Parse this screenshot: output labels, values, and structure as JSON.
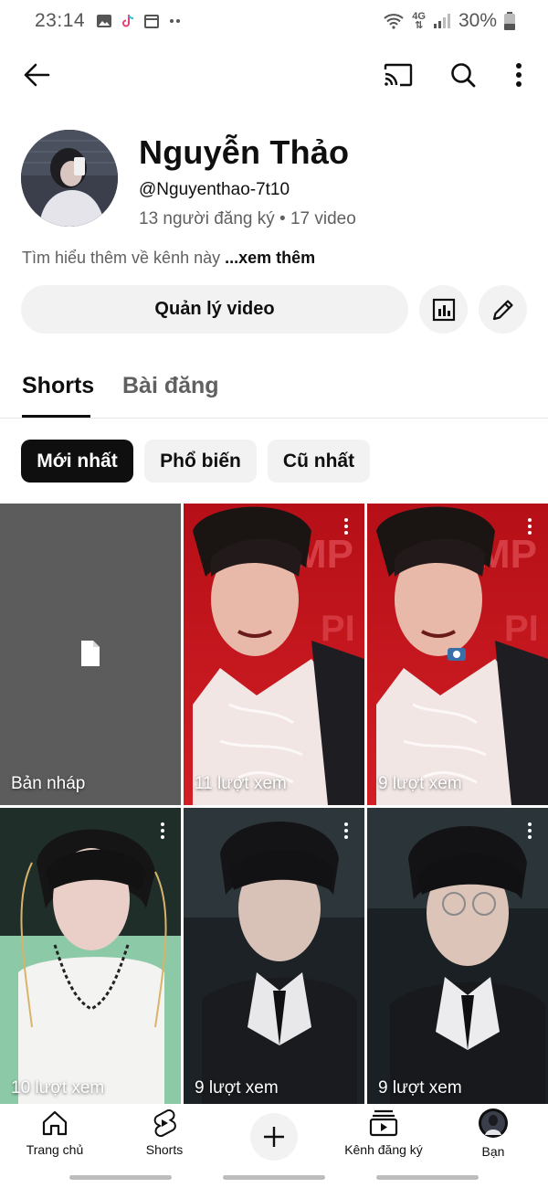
{
  "status_bar": {
    "time": "23:14",
    "network": "4G",
    "battery": "30%"
  },
  "app_bar": {
    "back_icon": "arrow-left-icon",
    "cast_icon": "cast-icon",
    "search_icon": "search-icon",
    "more_icon": "more-vert-icon"
  },
  "channel": {
    "name": "Nguyễn Thảo",
    "handle": "@Nguyenthao-7t10",
    "stats": "13 người đăng ký • 17 video",
    "description": "Tìm hiểu thêm về kênh này ",
    "more_link": "...xem thêm"
  },
  "actions": {
    "manage_label": "Quản lý video",
    "stats_icon": "analytics-icon",
    "edit_icon": "pencil-icon"
  },
  "tabs": [
    {
      "label": "Shorts",
      "active": true
    },
    {
      "label": "Bài đăng",
      "active": false
    }
  ],
  "chips": [
    {
      "label": "Mới nhất",
      "selected": true
    },
    {
      "label": "Phổ biến",
      "selected": false
    },
    {
      "label": "Cũ nhất",
      "selected": false
    }
  ],
  "shorts": [
    {
      "caption": "Bản nháp",
      "kind": "draft"
    },
    {
      "caption": "11 lượt xem",
      "kind": "video"
    },
    {
      "caption": "9 lượt xem",
      "kind": "video"
    },
    {
      "caption": "10 lượt xem",
      "kind": "video"
    },
    {
      "caption": "9 lượt xem",
      "kind": "video"
    },
    {
      "caption": "9 lượt xem",
      "kind": "video"
    }
  ],
  "bottom_nav": [
    {
      "label": "Trang chủ",
      "icon": "home-icon"
    },
    {
      "label": "Shorts",
      "icon": "shorts-icon"
    },
    {
      "label": "",
      "icon": "create-plus-icon"
    },
    {
      "label": "Kênh đăng ký",
      "icon": "subscriptions-icon"
    },
    {
      "label": "Bạn",
      "icon": "avatar-icon"
    }
  ],
  "colors": {
    "chip_bg": "#f2f2f2",
    "selected_chip_bg": "#0f0f0f",
    "secondary_text": "#606060",
    "thumb_red": "#c8151d"
  }
}
